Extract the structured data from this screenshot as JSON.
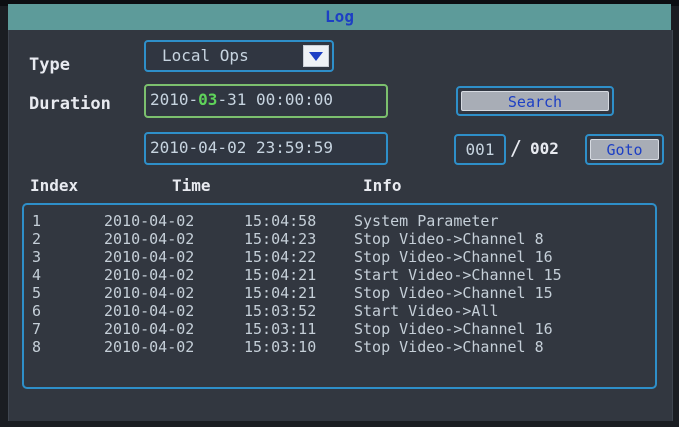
{
  "title": "Log",
  "type_label": "Type",
  "type_value": "Local Ops",
  "duration_label": "Duration",
  "start": {
    "year": "2010-",
    "month": "03",
    "rest": "-31 00:00:00"
  },
  "end_value": "2010-04-02 23:59:59",
  "search_label": "Search",
  "page_current": "001",
  "page_sep": "/",
  "page_total": "002",
  "goto_label": "Goto",
  "headers": {
    "index": "Index",
    "time": "Time",
    "info": "Info"
  },
  "rows": [
    {
      "index": "1",
      "date": "2010-04-02",
      "time": "15:04:58",
      "info": "System Parameter"
    },
    {
      "index": "2",
      "date": "2010-04-02",
      "time": "15:04:23",
      "info": "Stop Video->Channel 8"
    },
    {
      "index": "3",
      "date": "2010-04-02",
      "time": "15:04:22",
      "info": "Stop Video->Channel 16"
    },
    {
      "index": "4",
      "date": "2010-04-02",
      "time": "15:04:21",
      "info": "Start Video->Channel 15"
    },
    {
      "index": "5",
      "date": "2010-04-02",
      "time": "15:04:21",
      "info": "Stop Video->Channel 15"
    },
    {
      "index": "6",
      "date": "2010-04-02",
      "time": "15:03:52",
      "info": "Start Video->All"
    },
    {
      "index": "7",
      "date": "2010-04-02",
      "time": "15:03:11",
      "info": "Stop Video->Channel 16"
    },
    {
      "index": "8",
      "date": "2010-04-02",
      "time": "15:03:10",
      "info": "Stop Video->Channel 8"
    }
  ],
  "colors": {
    "title_bg": "#5d9b9a",
    "title_text": "#1d3fc4",
    "panel": "#323740",
    "border": "#2e8fc9",
    "highlight": "#5fd35a"
  }
}
